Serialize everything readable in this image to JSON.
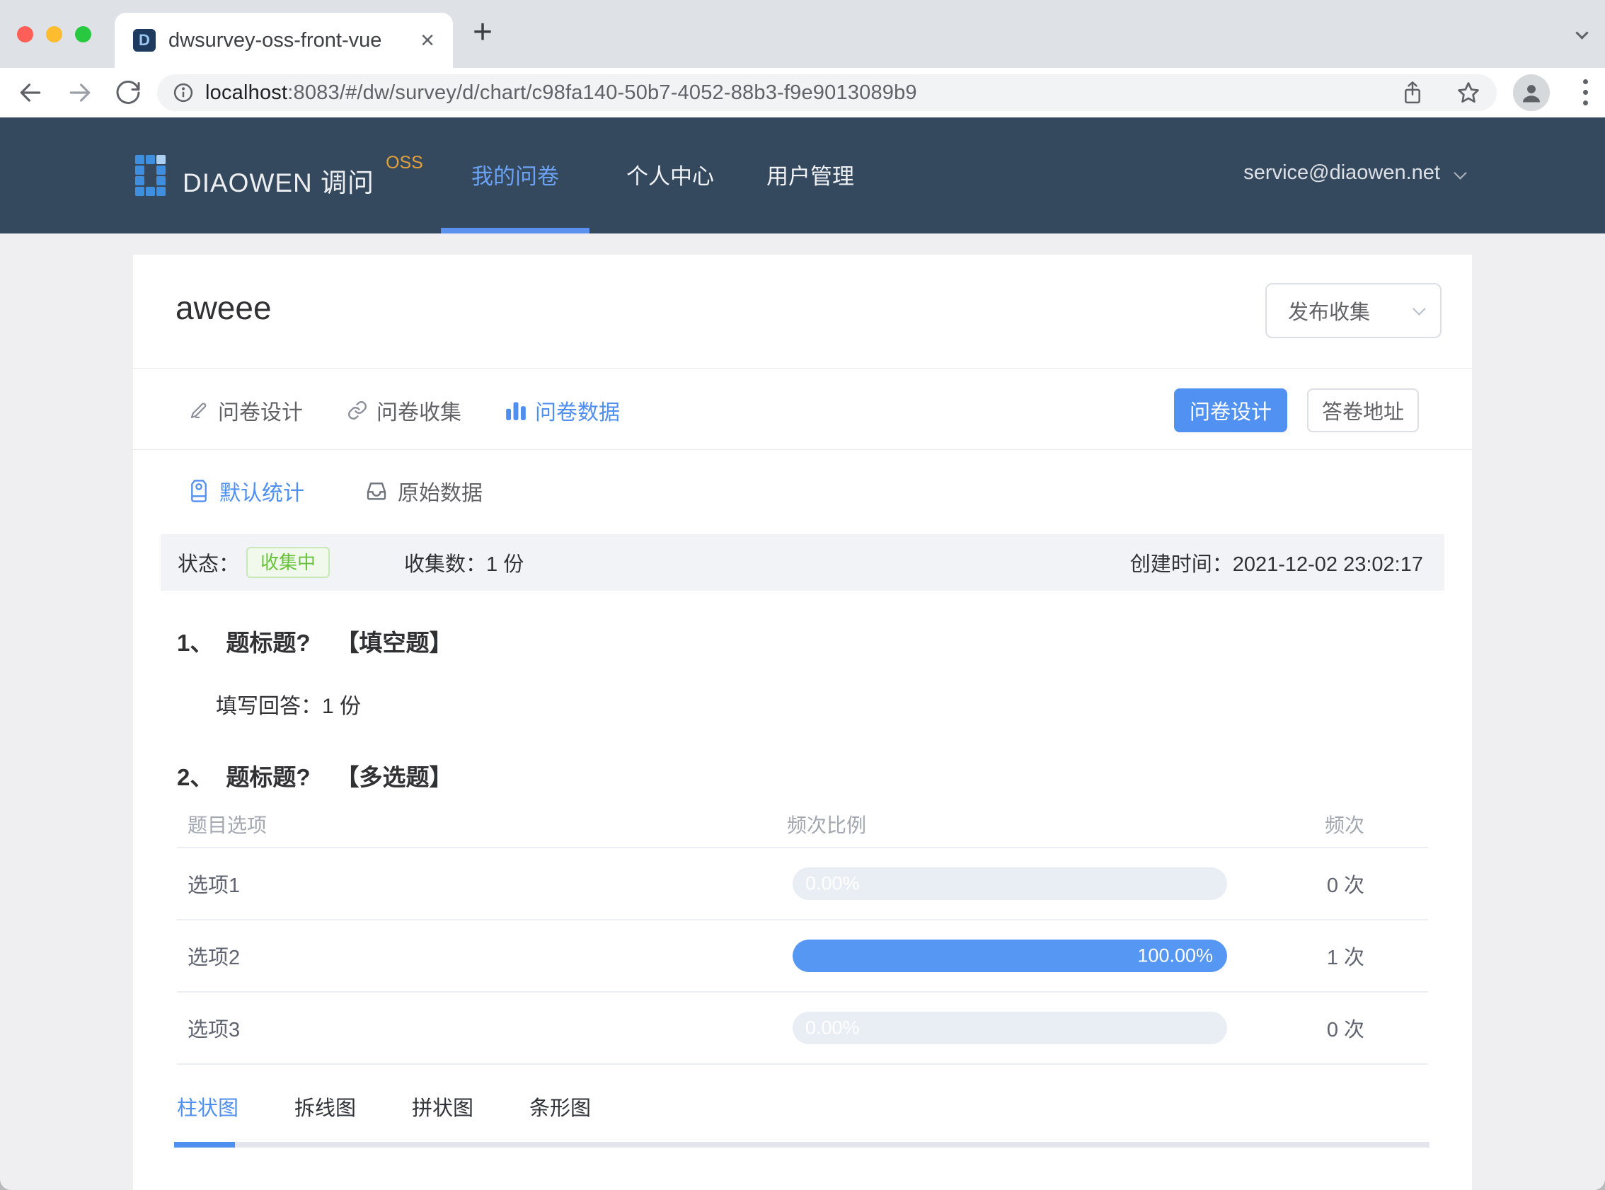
{
  "browser": {
    "tab": {
      "title": "dwsurvey-oss-front-vue",
      "close": "×",
      "new_tab": "+",
      "favicon_letter": "D"
    },
    "url": {
      "host": "localhost",
      "rest": ":8083/#/dw/survey/d/chart/c98fa140-50b7-4052-88b3-f9e9013089b9"
    }
  },
  "header": {
    "brand": {
      "name": "DIAOWEN 调问",
      "badge": "OSS"
    },
    "nav": [
      {
        "label": "我的问卷",
        "active": true
      },
      {
        "label": "个人中心",
        "active": false
      },
      {
        "label": "用户管理",
        "active": false
      }
    ],
    "user": {
      "email": "service@diaowen.net"
    }
  },
  "main": {
    "title": "aweee",
    "publish_select": {
      "value": "发布收集"
    },
    "survey_tabs": [
      {
        "label": "问卷设计",
        "icon": "pencil-icon",
        "active": false
      },
      {
        "label": "问卷收集",
        "icon": "link-icon",
        "active": false
      },
      {
        "label": "问卷数据",
        "icon": "bar-chart-icon",
        "active": true
      }
    ],
    "actions": {
      "design": "问卷设计",
      "answer_url": "答卷地址"
    },
    "data_tabs": [
      {
        "label": "默认统计",
        "icon": "tag-icon",
        "active": true
      },
      {
        "label": "原始数据",
        "icon": "inbox-icon",
        "active": false
      }
    ],
    "status_bar": {
      "status_label": "状态：",
      "status_badge": "收集中",
      "count_label": "收集数：",
      "count_value": "1 份",
      "created_label": "创建时间：",
      "created_value": "2021-12-02 23:02:17"
    },
    "questions": [
      {
        "no": "1、",
        "title": "题标题?",
        "type": "【填空题】",
        "answer_label": "填写回答：",
        "answer_value": "1 份"
      },
      {
        "no": "2、",
        "title": "题标题?",
        "type": "【多选题】"
      }
    ],
    "table": {
      "headers": [
        "题目选项",
        "频次比例",
        "频次"
      ],
      "rows": [
        {
          "option": "选项1",
          "percent": 0,
          "percent_label": "0.00%",
          "count": "0 次"
        },
        {
          "option": "选项2",
          "percent": 100,
          "percent_label": "100.00%",
          "count": "1 次"
        },
        {
          "option": "选项3",
          "percent": 0,
          "percent_label": "0.00%",
          "count": "0 次"
        }
      ]
    },
    "chart_tabs": [
      {
        "label": "柱状图",
        "active": true
      },
      {
        "label": "拆线图",
        "active": false
      },
      {
        "label": "拼状图",
        "active": false
      },
      {
        "label": "条形图",
        "active": false
      }
    ]
  },
  "colors": {
    "primary": "#5191f1",
    "header_bg": "#35495e",
    "success_text": "#67c23a",
    "success_bg": "#f0f9eb",
    "badge_orange": "#e2a13d",
    "bar_fill": "#5797f4",
    "bar_track": "#e9edf4"
  }
}
